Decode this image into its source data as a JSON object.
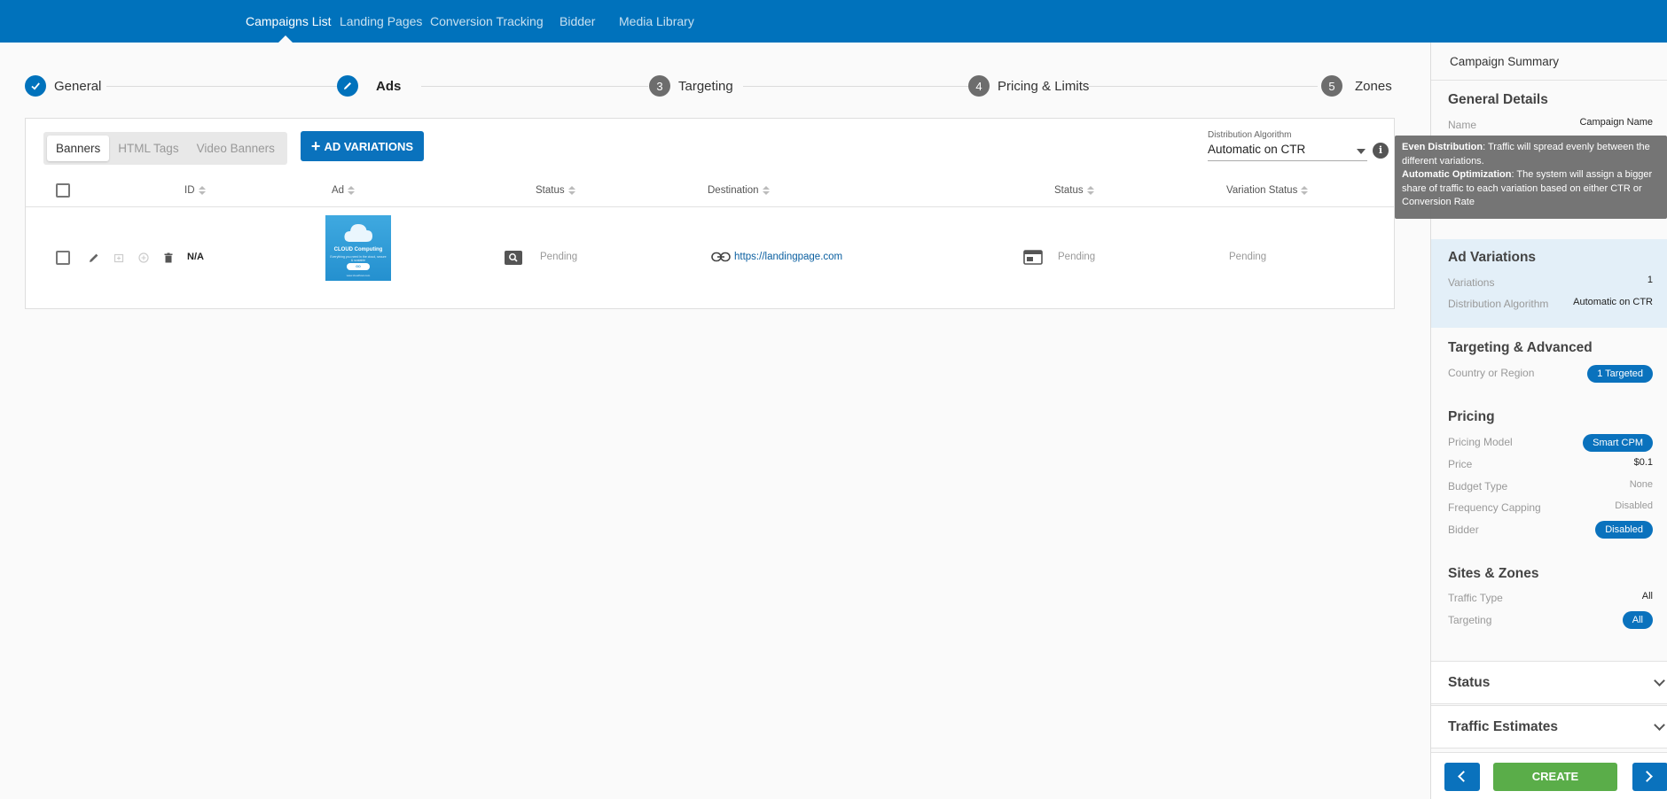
{
  "nav": {
    "tabs": [
      {
        "label": "Campaigns List"
      },
      {
        "label": "Landing Pages"
      },
      {
        "label": "Conversion Tracking"
      },
      {
        "label": "Bidder"
      },
      {
        "label": "Media Library"
      }
    ]
  },
  "stepper": {
    "steps": [
      {
        "number": "",
        "label": "General",
        "state": "done"
      },
      {
        "number": "",
        "label": "Ads",
        "state": "current"
      },
      {
        "number": "3",
        "label": "Targeting",
        "state": "todo"
      },
      {
        "number": "4",
        "label": "Pricing & Limits",
        "state": "todo"
      },
      {
        "number": "5",
        "label": "Zones",
        "state": "todo"
      }
    ]
  },
  "ads": {
    "segments": [
      "Banners",
      "HTML Tags",
      "Video Banners"
    ],
    "add_button": "AD VARIATIONS",
    "distribution": {
      "label": "Distribution Algorithm",
      "value": "Automatic on CTR",
      "info_icon": "i"
    },
    "columns": [
      "ID",
      "Ad",
      "Status",
      "Destination",
      "Status",
      "Variation Status"
    ],
    "rows": [
      {
        "id": "N/A",
        "ad_title": "CLOUD Computing",
        "ad_subtitle": "Everything you need in the cloud, secure & scalable",
        "ad_button": "GO",
        "ad_footer": "www.cloudhost.com",
        "status": "Pending",
        "destination": "https://landingpage.com",
        "lp_status": "Pending",
        "variation_status": "Pending"
      }
    ]
  },
  "tooltip": {
    "line1_bold": "Even Distribution",
    "line1_text": ": Traffic will spread evenly between the different variations.",
    "line2_bold": "Automatic Optimization",
    "line2_text": ": The system will assign a bigger share of traffic to each variation based on either CTR or Conversion Rate"
  },
  "sidebar": {
    "title": "Campaign Summary",
    "general": {
      "title": "General Details",
      "name_label": "Name",
      "name_value": "Campaign Name"
    },
    "ad_variations": {
      "title": "Ad Variations",
      "variations_label": "Variations",
      "variations_value": "1",
      "algo_label": "Distribution Algorithm",
      "algo_value": "Automatic on CTR"
    },
    "targeting": {
      "title": "Targeting & Advanced",
      "country_label": "Country or Region",
      "country_value": "1 Targeted"
    },
    "pricing": {
      "title": "Pricing",
      "model_label": "Pricing Model",
      "model_value": "Smart CPM",
      "price_label": "Price",
      "price_value": "$0.1",
      "budget_label": "Budget Type",
      "budget_value": "None",
      "freq_label": "Frequency Capping",
      "freq_value": "Disabled",
      "bidder_label": "Bidder",
      "bidder_value": "Disabled"
    },
    "sites": {
      "title": "Sites & Zones",
      "traffic_label": "Traffic Type",
      "traffic_value": "All",
      "targeting_label": "Targeting",
      "targeting_value": "All"
    },
    "status_title": "Status",
    "traffic_estimates_title": "Traffic Estimates",
    "create_button": "CREATE"
  },
  "colors": {
    "brand_blue": "#0072bc",
    "create_green": "#5aad49"
  }
}
